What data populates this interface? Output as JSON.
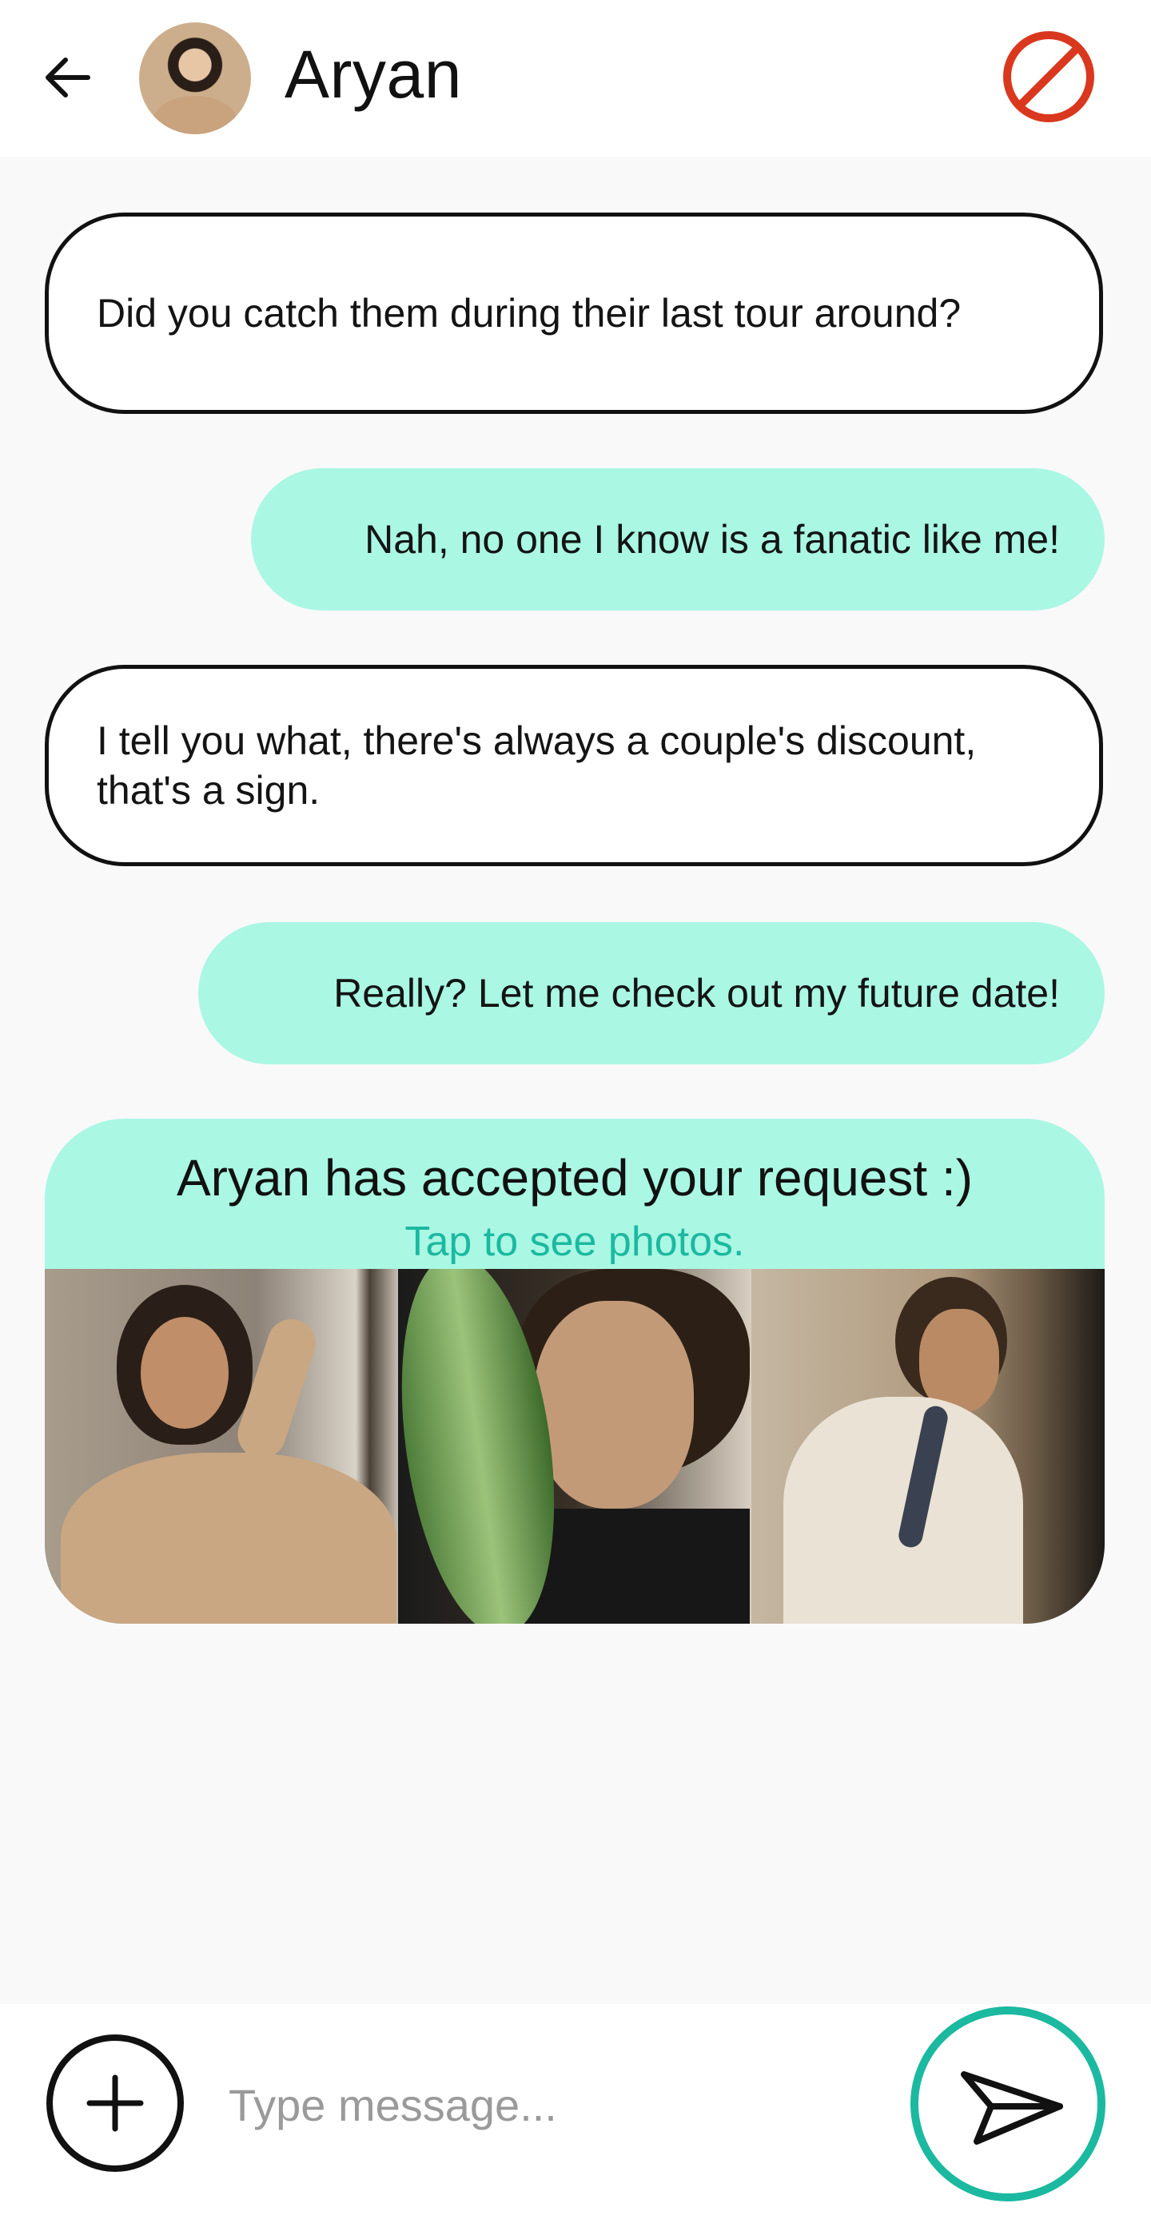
{
  "header": {
    "contact_name": "Aryan",
    "back_icon": "arrow-left-icon",
    "block_icon": "block-icon",
    "block_color": "#d9381e"
  },
  "messages": [
    {
      "direction": "incoming",
      "text": "Did you catch them during their last tour around?"
    },
    {
      "direction": "outgoing",
      "text": "Nah, no one I know is a fanatic like me!"
    },
    {
      "direction": "incoming",
      "text": "I tell you what, there's always a couple's discount, that's a sign."
    },
    {
      "direction": "outgoing",
      "text": "Really? Let me check out my future date!"
    }
  ],
  "accepted_card": {
    "title": "Aryan has accepted your request :)",
    "link": "Tap to see photos.",
    "accent_color": "#aaf7e4",
    "link_color": "#1bb9a0"
  },
  "composer": {
    "placeholder": "Type message...",
    "add_icon": "plus-icon",
    "send_icon": "send-icon",
    "send_ring_color": "#1bb9a0"
  }
}
